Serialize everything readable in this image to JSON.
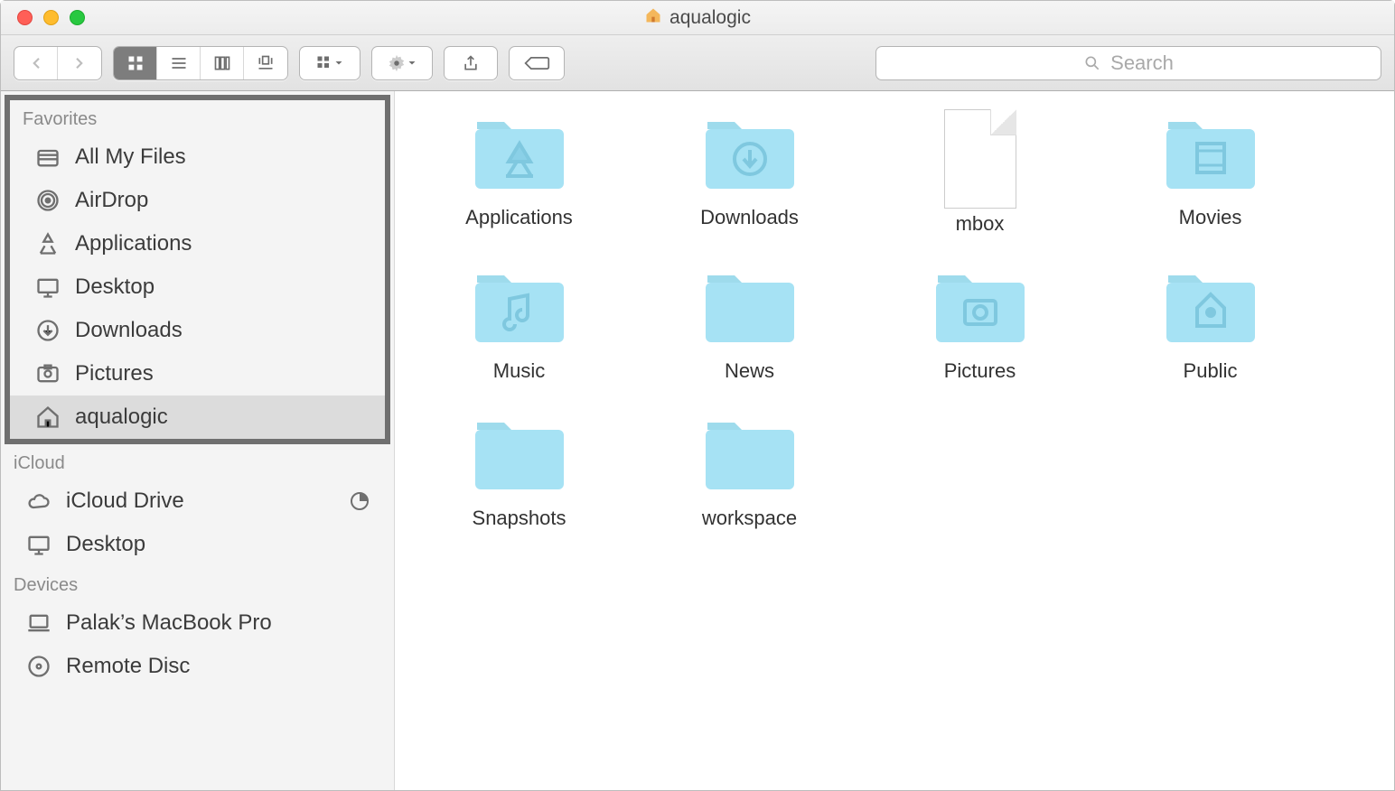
{
  "window": {
    "title": "aqualogic"
  },
  "toolbar": {
    "search_placeholder": "Search"
  },
  "sidebar": {
    "sections": [
      {
        "label": "Favorites",
        "highlighted": true,
        "items": [
          {
            "label": "All My Files",
            "icon": "all-my-files"
          },
          {
            "label": "AirDrop",
            "icon": "airdrop"
          },
          {
            "label": "Applications",
            "icon": "applications"
          },
          {
            "label": "Desktop",
            "icon": "desktop"
          },
          {
            "label": "Downloads",
            "icon": "downloads"
          },
          {
            "label": "Pictures",
            "icon": "pictures"
          },
          {
            "label": "aqualogic",
            "icon": "home",
            "selected": true
          }
        ]
      },
      {
        "label": "iCloud",
        "items": [
          {
            "label": "iCloud Drive",
            "icon": "cloud",
            "extra": "progress"
          },
          {
            "label": "Desktop",
            "icon": "desktop"
          }
        ]
      },
      {
        "label": "Devices",
        "items": [
          {
            "label": "Palak’s MacBook Pro",
            "icon": "laptop"
          },
          {
            "label": "Remote Disc",
            "icon": "disc"
          }
        ]
      }
    ]
  },
  "content": {
    "items": [
      {
        "label": "Applications",
        "type": "folder",
        "glyph": "apps"
      },
      {
        "label": "Downloads",
        "type": "folder",
        "glyph": "download"
      },
      {
        "label": "mbox",
        "type": "file",
        "glyph": "doc"
      },
      {
        "label": "Movies",
        "type": "folder",
        "glyph": "movie"
      },
      {
        "label": "Music",
        "type": "folder",
        "glyph": "music"
      },
      {
        "label": "News",
        "type": "folder",
        "glyph": "plain"
      },
      {
        "label": "Pictures",
        "type": "folder",
        "glyph": "camera"
      },
      {
        "label": "Public",
        "type": "folder",
        "glyph": "public"
      },
      {
        "label": "Snapshots",
        "type": "folder",
        "glyph": "plain"
      },
      {
        "label": "workspace",
        "type": "folder",
        "glyph": "plain"
      }
    ]
  }
}
